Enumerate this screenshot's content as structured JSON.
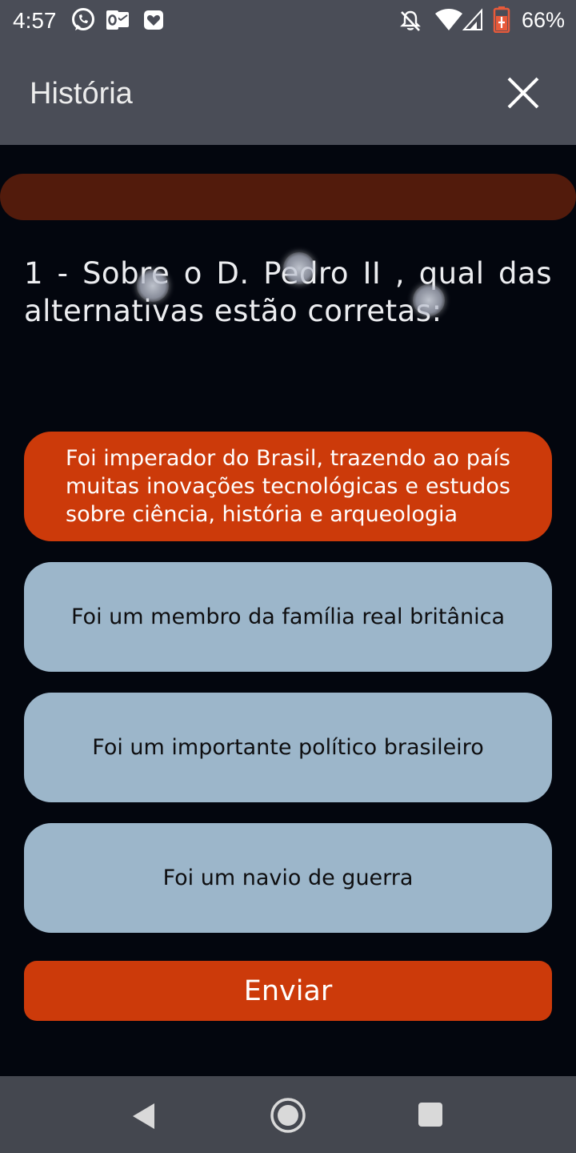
{
  "status_bar": {
    "time": "4:57",
    "battery_percent": "66%",
    "left_icons": [
      "whatsapp-icon",
      "outlook-icon",
      "heart-notification-icon"
    ],
    "right_icons": [
      "bell-off-icon",
      "wifi-icon",
      "signal-icon",
      "battery-icon"
    ]
  },
  "app_bar": {
    "title": "História",
    "close_icon": "close-icon"
  },
  "progress": {
    "value": 0,
    "track_color": "#521b0c",
    "fill_color": "#cc3a0a"
  },
  "question": {
    "text": "1 - Sobre o D. Pedro II , qual das alternativas estão corretas:"
  },
  "options": [
    {
      "label": "Foi imperador do Brasil, trazendo ao país muitas inovações tecnológicas e estudos sobre ciência, história e arqueologia",
      "selected": true
    },
    {
      "label": "Foi um membro da família real britânica",
      "selected": false
    },
    {
      "label": "Foi um importante político brasileiro",
      "selected": false
    },
    {
      "label": "Foi um navio de guerra",
      "selected": false
    }
  ],
  "submit": {
    "label": "Enviar"
  },
  "colors": {
    "accent": "#cc3a0a",
    "option_bg": "#9cb6ca",
    "background": "#03060e",
    "bar_bg": "#4a4d57"
  },
  "nav_bar": {
    "icons": [
      "back-icon",
      "home-icon",
      "recents-icon"
    ]
  }
}
